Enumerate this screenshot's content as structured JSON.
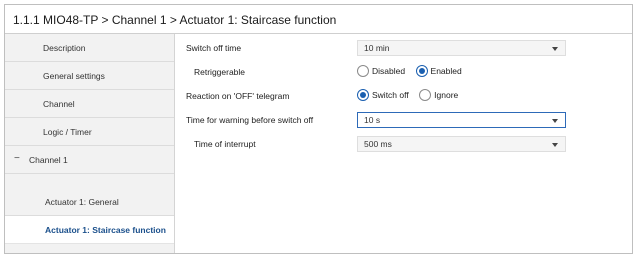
{
  "window": {
    "title": "1.1.1 MIO48-TP > Channel 1 > Actuator 1: Staircase function"
  },
  "sidebar": {
    "items": [
      {
        "label": "Description"
      },
      {
        "label": "General settings"
      },
      {
        "label": "Channel"
      },
      {
        "label": "Logic / Timer"
      },
      {
        "label": "Channel 1",
        "expanded_symbol": "−"
      },
      {
        "label": "Actuator 1: General"
      },
      {
        "label": "Actuator 1: Staircase function",
        "selected": true
      }
    ]
  },
  "params": {
    "switch_off_time": {
      "label": "Switch off time",
      "value": "10 min"
    },
    "retriggerable": {
      "label": "Retriggerable",
      "options": [
        "Disabled",
        "Enabled"
      ],
      "selected": "Enabled"
    },
    "reaction_off": {
      "label": "Reaction on 'OFF' telegram",
      "options": [
        "Switch off",
        "Ignore"
      ],
      "selected": "Switch off"
    },
    "warning_time": {
      "label": "Time for warning before switch off",
      "value": "10 s"
    },
    "time_of_interrupt": {
      "label": "Time of interrupt",
      "value": "500 ms"
    }
  },
  "colors": {
    "accent": "#1a5fb0",
    "selected_nav_text": "#1a4f8b",
    "focus_border": "#2d6ab8",
    "sidebar_bg": "#f2f2f2"
  },
  "icons": {
    "dropdown": "chevron-down-icon",
    "collapse": "minus-icon"
  }
}
